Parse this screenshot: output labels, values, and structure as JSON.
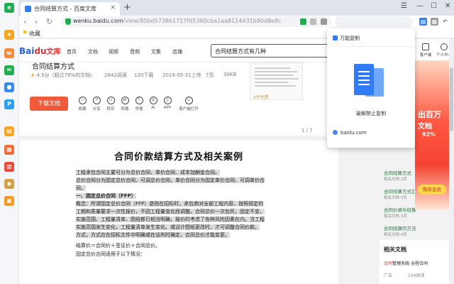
{
  "browser": {
    "tab_title": "合同结算方式 - 百度文库",
    "tab_close": "×",
    "new_tab": "+",
    "url_host": "wenku.baidu.com",
    "url_path": "/view/85bd5738b1717fd5360cba1aa8114431b90d8e8c",
    "bookmark_label": "收藏"
  },
  "site": {
    "logo_bai": "Bai",
    "logo_du": "du",
    "logo_wenku": "文库",
    "nav": [
      "首页",
      "文档",
      "视频",
      "音频",
      "文集",
      "店铺"
    ],
    "search_value": "合同结算方式有几种"
  },
  "doc": {
    "title_cut": "合同结算方式",
    "rating": "4.5分（超过78%的文档）",
    "reads": "2842阅读",
    "downloads": "120下载",
    "date": "2019-05-31上传",
    "pages": "7页",
    "size": "30KB",
    "vip_tag": "VIP免费",
    "download_label": "下载文档",
    "actions": [
      "收藏",
      "分享",
      "转存",
      "转格",
      "举报",
      "AI",
      "APP",
      "客户端打开"
    ],
    "page_indicator": "1 / 7",
    "heading": "合同价款结算方式及相关案例",
    "paragraphs": [
      "工程承包合同主要可分为总价合同、单价合同、成本加酬金合同。",
      "总价合同分为固定总价合同、可调总价合同，单价合同分为固定单价合同、可调单价合",
      "同。",
      "一、固定总价合同（FFP）",
      "概念：所谓固定总价合同（FFP）是指在招标时，承包商对全部工程内容，按照规定的",
      "工期和质量要求一次性报价，不因工程量变化而调整。合同总价一次包死，固定不变，",
      "实施范围、工程量清单、图纸都已相当明确，报价时考虑了各种风险因素在内。当工程",
      "实施范围发生变化，工程量清单发生变化、或设计图纸更改时，才可调整合同价款。",
      "方式，方式应在招标文件中明确或在谈判时确定，合同总价才能变更。",
      "结算价＝合同价＋签证价＋合同总价。",
      "固定总价合同适用于以下情况："
    ]
  },
  "popup": {
    "title": "万能复制",
    "caption": "破解禁止复制",
    "site": "baidu.com"
  },
  "right": {
    "user_labels": [
      "客户端",
      "个人中心"
    ],
    "links": [
      {
        "title": "合同结算方式",
        "sub": "相关文档 2页"
      },
      {
        "title": "合同结算方式汇总",
        "sub": "相关文档 5页"
      },
      {
        "title": "合同价格与结算",
        "sub": "相关文档 3页"
      },
      {
        "title": "合同结算的方法",
        "sub": "相关文档 4页"
      },
      {
        "title": "常见合同结算方式",
        "sub": "相关文档 6页"
      },
      {
        "title": "工程合同结算方式",
        "sub": "相关文档 2页"
      }
    ],
    "related_title": "相关文档",
    "related_link_prefix": "合同",
    "related_link_rest": "管理系统-全程合同",
    "related_meta": [
      "广告",
      "234阅读"
    ]
  },
  "promo": {
    "line1": "出百万",
    "line2": "文档",
    "percent": "92%",
    "button": "购买会员"
  }
}
